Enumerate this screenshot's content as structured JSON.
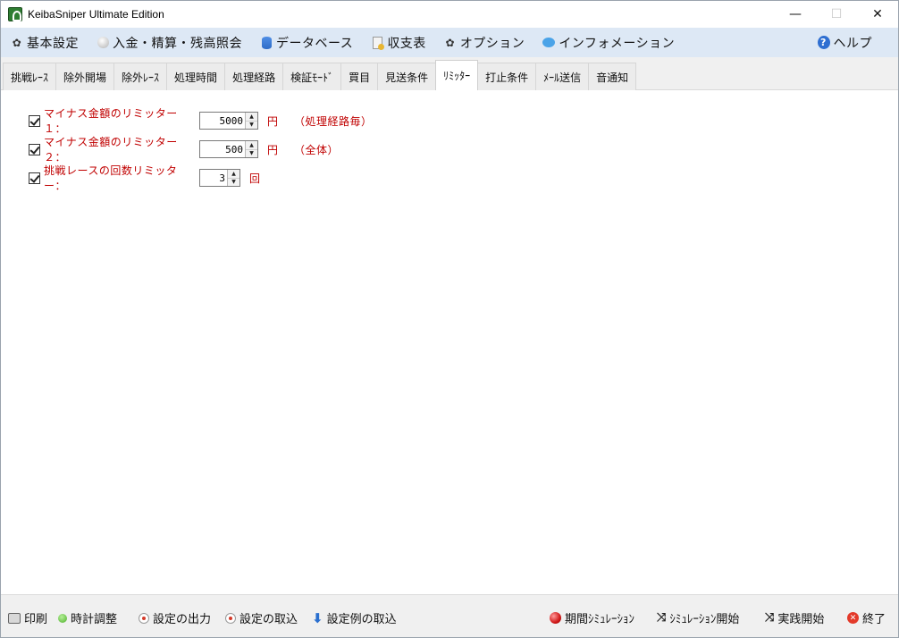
{
  "window": {
    "title": "KeibaSniper Ultimate Edition",
    "minimize": "—",
    "maximize": "☐",
    "close": "✕"
  },
  "menu": {
    "items": [
      {
        "label": "基本設定",
        "icon": "gear-icon"
      },
      {
        "label": "入金・精算・残高照会",
        "icon": "coin-icon"
      },
      {
        "label": "データベース",
        "icon": "database-icon"
      },
      {
        "label": "収支表",
        "icon": "ledger-icon"
      },
      {
        "label": "オプション",
        "icon": "gear-icon"
      },
      {
        "label": "インフォメーション",
        "icon": "chat-bubble-icon"
      }
    ],
    "help": {
      "label": "ヘルプ",
      "icon": "help-icon"
    }
  },
  "tabs": [
    "挑戦ﾚｰｽ",
    "除外開場",
    "除外ﾚｰｽ",
    "処理時間",
    "処理経路",
    "検証ﾓｰﾄﾞ",
    "買目",
    "見送条件",
    "ﾘﾐｯﾀｰ",
    "打止条件",
    "ﾒｰﾙ送信",
    "音通知"
  ],
  "active_tab": "ﾘﾐｯﾀｰ",
  "limiter": {
    "row1": {
      "checked": true,
      "label": "マイナス金額のリミッター１：",
      "value": "5000",
      "unit": "円",
      "note": "（処理経路毎）"
    },
    "row2": {
      "checked": true,
      "label": "マイナス金額のリミッター２：",
      "value": "500",
      "unit": "円",
      "note": "（全体）"
    },
    "row3": {
      "checked": true,
      "label": "挑戦レースの回数リミッター：",
      "value": "3",
      "unit": "回"
    }
  },
  "bottom": {
    "print": "印刷",
    "clock_adjust": "時計調整",
    "export_settings": "設定の出力",
    "import_settings": "設定の取込",
    "import_sample_settings": "設定例の取込",
    "period_simulation": "期間ｼﾐｭﾚｰｼｮﾝ",
    "simulation_start": "ｼﾐｭﾚｰｼｮﾝ開始",
    "live_start": "実践開始",
    "exit": "終了"
  },
  "colors": {
    "menubar": "#dde8f5",
    "label_red": "#c00000"
  }
}
